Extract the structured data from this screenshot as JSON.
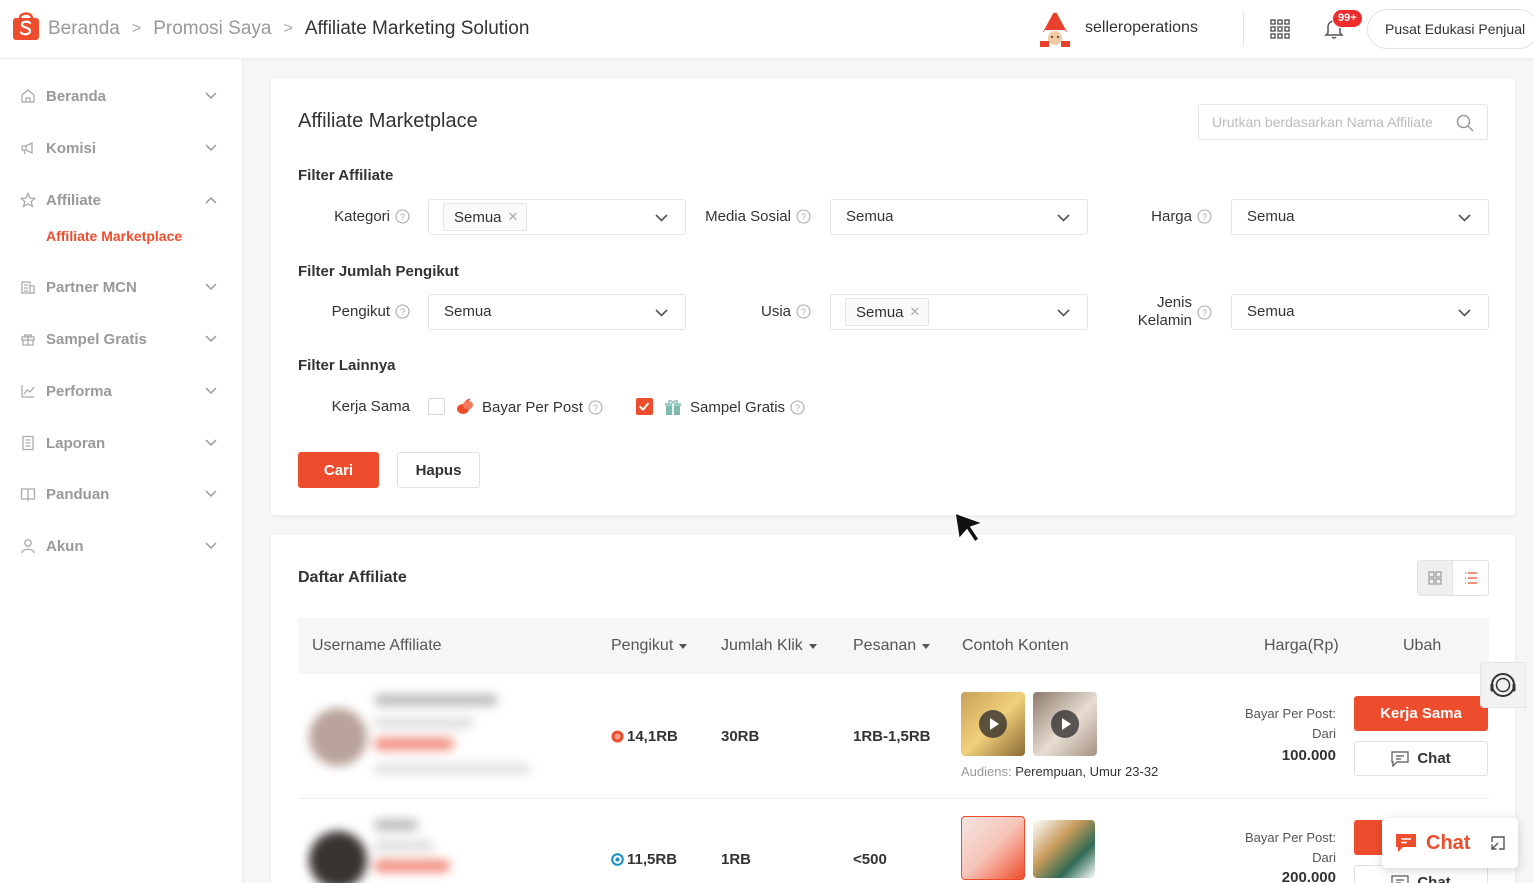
{
  "header": {
    "breadcrumb": [
      "Beranda",
      "Promosi Saya",
      "Affiliate Marketing Solution"
    ],
    "username": "selleroperations",
    "notification_badge": "99+",
    "edu_button": "Pusat Edukasi Penjual"
  },
  "sidebar": {
    "items": [
      {
        "label": "Beranda",
        "icon": "home-icon"
      },
      {
        "label": "Komisi",
        "icon": "megaphone-icon"
      },
      {
        "label": "Affiliate",
        "icon": "star-icon"
      },
      {
        "label": "Partner MCN",
        "icon": "building-icon"
      },
      {
        "label": "Sampel Gratis",
        "icon": "gift-icon"
      },
      {
        "label": "Performa",
        "icon": "chart-icon"
      },
      {
        "label": "Laporan",
        "icon": "document-icon"
      },
      {
        "label": "Panduan",
        "icon": "book-icon"
      },
      {
        "label": "Akun",
        "icon": "person-icon"
      }
    ],
    "active_sub": "Affiliate Marketplace"
  },
  "filters": {
    "title": "Affiliate Marketplace",
    "search_placeholder": "Urutkan berdasarkan Nama Affiliate",
    "section_affiliate": "Filter Affiliate",
    "kategori_label": "Kategori",
    "kategori_tag": "Semua",
    "media_label": "Media Sosial",
    "media_value": "Semua",
    "harga_label": "Harga",
    "harga_value": "Semua",
    "section_pengikut": "Filter Jumlah Pengikut",
    "pengikut_label": "Pengikut",
    "pengikut_value": "Semua",
    "usia_label": "Usia",
    "usia_tag": "Semua",
    "jenis_label_1": "Jenis",
    "jenis_label_2": "Kelamin",
    "jenis_value": "Semua",
    "section_lainnya": "Filter Lainnya",
    "kerja_label": "Kerja Sama",
    "opt_bayar": "Bayar Per Post",
    "opt_sampel": "Sampel Gratis",
    "bayar_checked": false,
    "sampel_checked": true,
    "btn_cari": "Cari",
    "btn_hapus": "Hapus"
  },
  "list": {
    "title": "Daftar Affiliate",
    "columns": [
      "Username Affiliate",
      "Pengikut",
      "Jumlah Klik",
      "Pesanan",
      "Contoh Konten",
      "Harga(Rp)",
      "Ubah"
    ],
    "rows": [
      {
        "followers": "14,1RB",
        "clicks": "30RB",
        "orders": "1RB-1,5RB",
        "audience_label": "Audiens:",
        "audience_value": "Perempuan, Umur 23-32",
        "price_label": "Bayar Per Post:",
        "price_from": "Dari",
        "price_value": "100.000",
        "btn_kerja": "Kerja Sama",
        "btn_chat": "Chat"
      },
      {
        "followers": "11,5RB",
        "clicks": "1RB",
        "orders": "<500",
        "price_label": "Bayar Per Post:",
        "price_from": "Dari",
        "price_value": "200.000",
        "btn_chat": "Chat"
      }
    ]
  },
  "floating": {
    "chat_label": "Chat"
  },
  "colors": {
    "accent": "#ee4d2d",
    "badge": "#ee2c2c"
  }
}
